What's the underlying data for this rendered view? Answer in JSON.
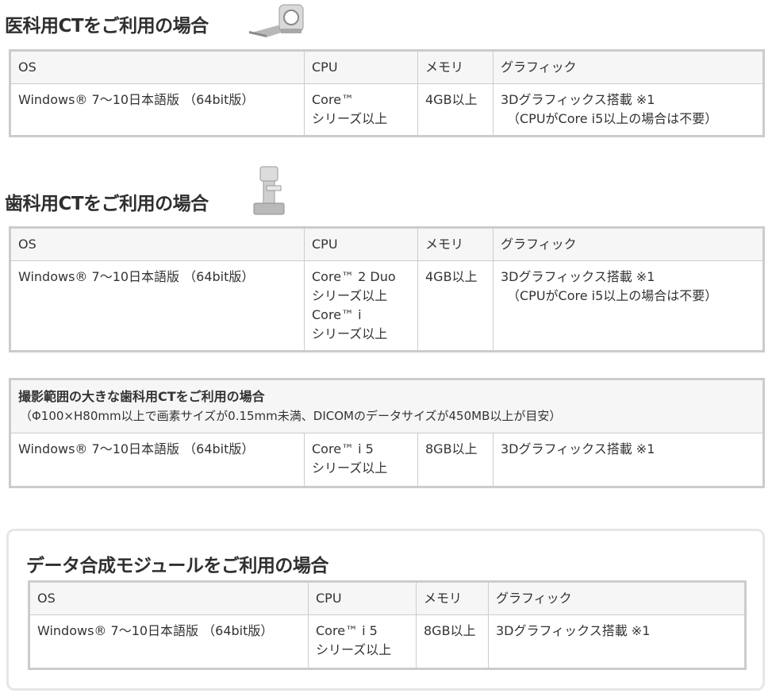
{
  "sections": [
    {
      "title": "医科用CTをご利用の場合",
      "icon": "ct-scanner-icon",
      "headers": [
        "OS",
        "CPU",
        "メモリ",
        "グラフィック"
      ],
      "row": {
        "os": "Windows® 7〜10日本語版 （64bit版）",
        "cpu": [
          "Core™",
          "シリーズ以上"
        ],
        "memory": "4GB以上",
        "graphics": "3Dグラフィックス搭載 ※1",
        "graphics_note": "（CPUがCore i5以上の場合は不要）"
      }
    },
    {
      "title": "歯科用CTをご利用の場合",
      "icon": "dental-ct-icon",
      "headers": [
        "OS",
        "CPU",
        "メモリ",
        "グラフィック"
      ],
      "row": {
        "os": "Windows® 7〜10日本語版 （64bit版）",
        "cpu": [
          "Core™ 2 Duo",
          "シリーズ以上",
          "Core™ i",
          "シリーズ以上"
        ],
        "memory": "4GB以上",
        "graphics": "3Dグラフィックス搭載 ※1",
        "graphics_note": "（CPUがCore i5以上の場合は不要）"
      }
    },
    {
      "title": "撮影範囲の大きな歯科用CTをご利用の場合",
      "subtitle": "（Φ100×H80mm以上で画素サイズが0.15mm未満、DICOMのデータサイズが450MB以上が目安）",
      "row": {
        "os": "Windows® 7〜10日本語版 （64bit版）",
        "cpu": [
          "Core™ i 5",
          "シリーズ以上"
        ],
        "memory": "8GB以上",
        "graphics": "3Dグラフィックス搭載 ※1"
      }
    },
    {
      "title": "データ合成モジュールをご利用の場合",
      "headers": [
        "OS",
        "CPU",
        "メモリ",
        "グラフィック"
      ],
      "row": {
        "os": "Windows® 7〜10日本語版 （64bit版）",
        "cpu": [
          "Core™ i 5",
          "シリーズ以上"
        ],
        "memory": "8GB以上",
        "graphics": "3Dグラフィックス搭載 ※1"
      }
    }
  ],
  "colors": {
    "border": "#cccccc",
    "header_bg": "#f6f6f6",
    "text": "#333333",
    "panel_border": "#e6e6e6"
  }
}
